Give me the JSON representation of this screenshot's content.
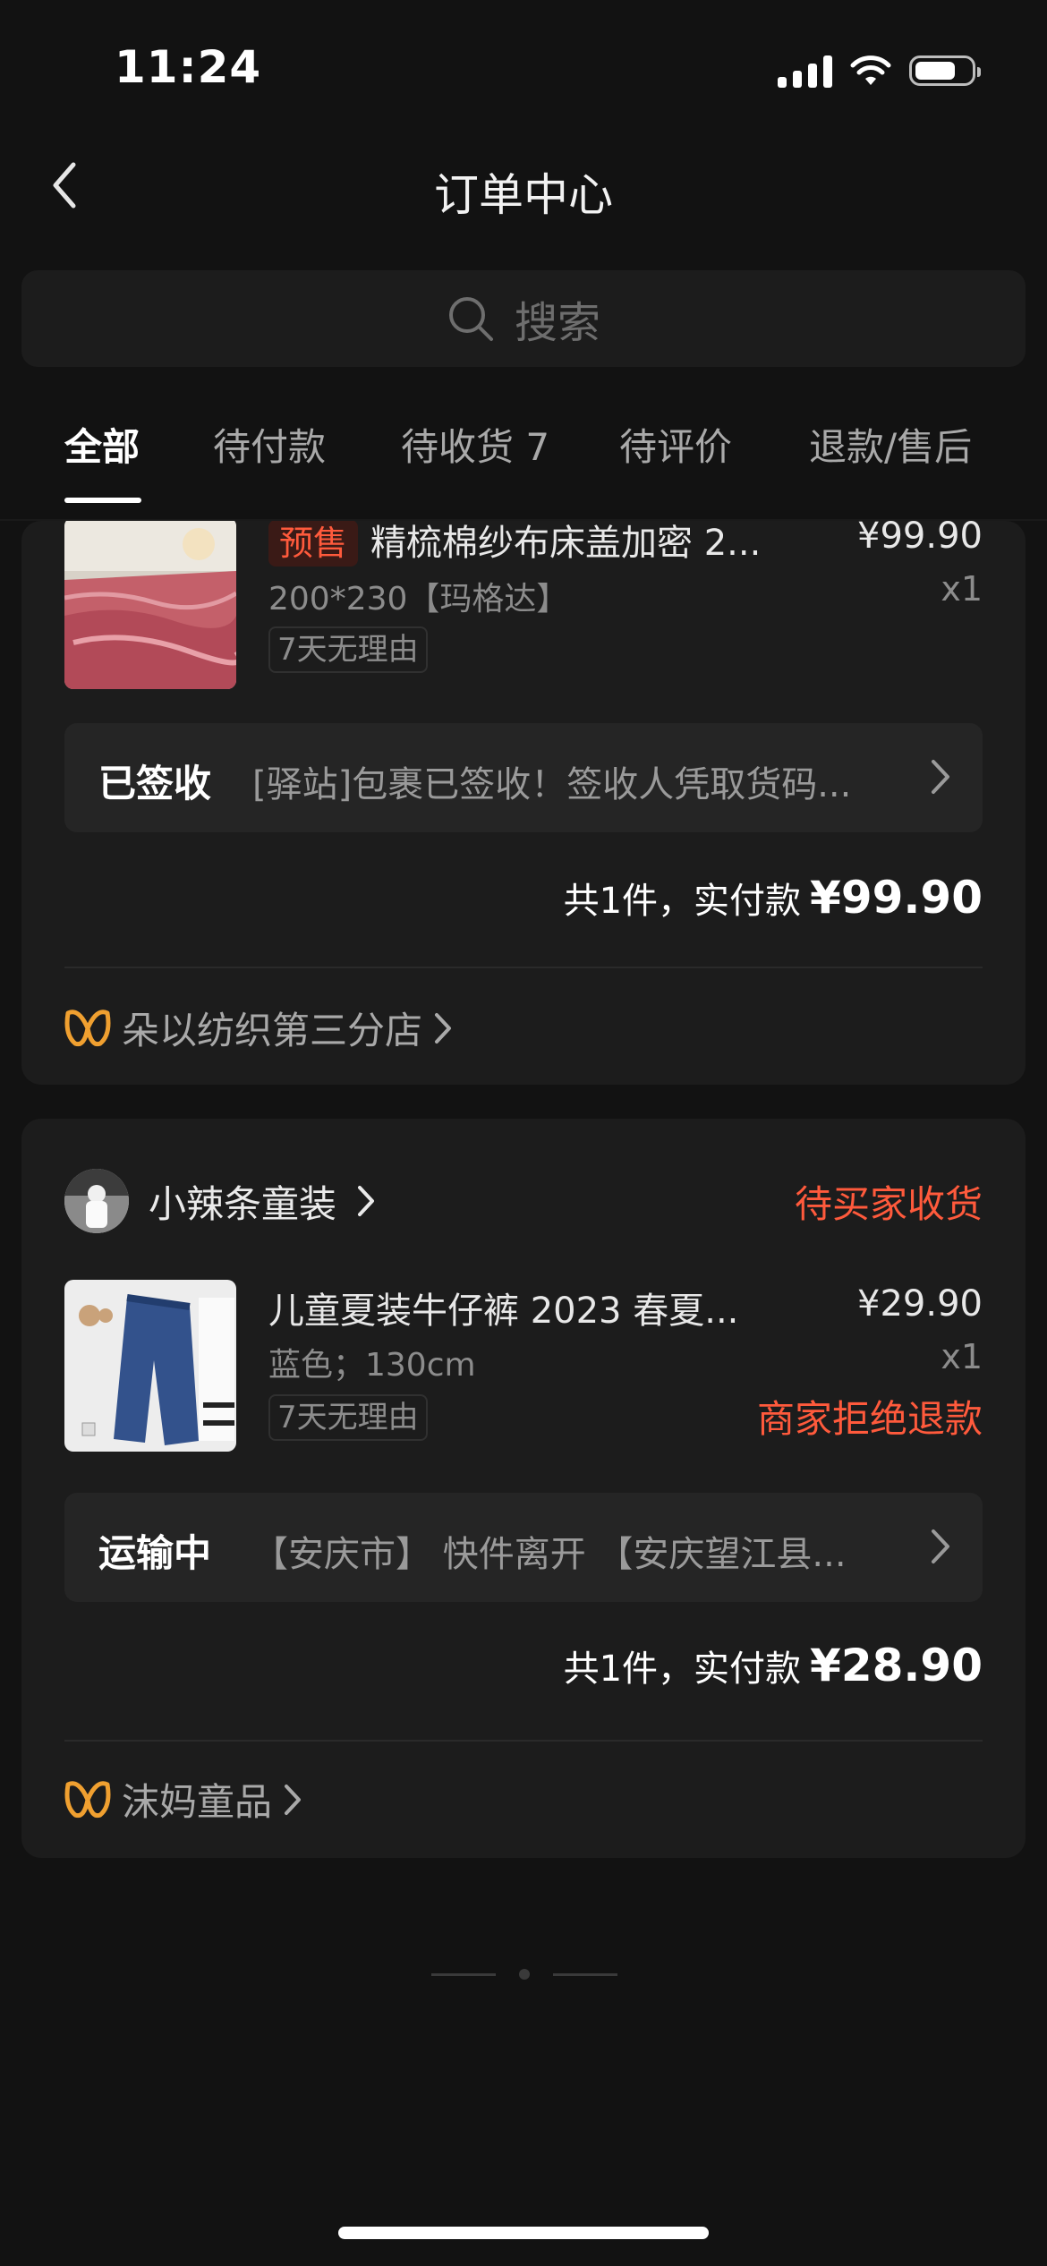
{
  "status_bar": {
    "time": "11:24"
  },
  "header": {
    "title": "订单中心"
  },
  "search": {
    "placeholder": "搜索"
  },
  "tabs": [
    {
      "label": "全部",
      "active": true
    },
    {
      "label": "待付款"
    },
    {
      "label": "待收货 7"
    },
    {
      "label": "待评价"
    },
    {
      "label": "退款/售后"
    }
  ],
  "orders": [
    {
      "product": {
        "badge": "预售",
        "title": "精梳棉纱布床盖加密 2...",
        "spec": "200*230【玛格达】",
        "tag": "7天无理由",
        "price": "¥99.90",
        "qty": "x1"
      },
      "logistics": {
        "status": "已签收",
        "detail": "[驿站]包裹已签收！签收人凭取货码..."
      },
      "total": {
        "label": "共1件，实付款",
        "amount": "¥99.90"
      },
      "store_link": "朵以纺织第三分店"
    },
    {
      "shop_name": "小辣条童装",
      "order_status": "待买家收货",
      "product": {
        "title": "儿童夏装牛仔裤 2023 春夏...",
        "spec": "蓝色；130cm",
        "tag": "7天无理由",
        "price": "¥29.90",
        "qty": "x1",
        "refund_status": "商家拒绝退款"
      },
      "logistics": {
        "status": "运输中",
        "detail": "【安庆市】 快件离开 【安庆望江县..."
      },
      "total": {
        "label": "共1件，实付款",
        "amount": "¥28.90"
      },
      "store_link": "沫妈童品"
    }
  ],
  "colors": {
    "accent_red": "#ff5a3c",
    "store_icon": "#f0a030",
    "background": "#121212",
    "card": "#1c1c1c"
  }
}
